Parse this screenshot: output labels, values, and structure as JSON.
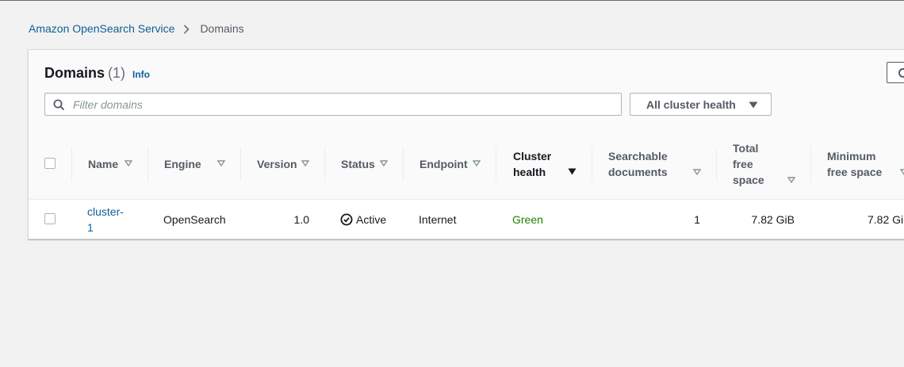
{
  "breadcrumb": {
    "service": "Amazon OpenSearch Service",
    "current": "Domains"
  },
  "panel": {
    "title": "Domains",
    "count": "(1)",
    "info": "Info",
    "search_placeholder": "Filter domains",
    "health_filter": "All cluster health"
  },
  "table": {
    "columns": [
      {
        "line1": "Name",
        "line2": "",
        "line3": ""
      },
      {
        "line1": "Engine",
        "line2": "",
        "line3": ""
      },
      {
        "line1": "Version",
        "line2": "",
        "line3": ""
      },
      {
        "line1": "Status",
        "line2": "",
        "line3": ""
      },
      {
        "line1": "Endpoint",
        "line2": "",
        "line3": ""
      },
      {
        "line1": "Cluster",
        "line2": "health",
        "line3": ""
      },
      {
        "line1": "Searchable",
        "line2": "documents",
        "line3": ""
      },
      {
        "line1": "Total",
        "line2": "free",
        "line3": "space"
      },
      {
        "line1": "Minimum",
        "line2": "free space",
        "line3": ""
      }
    ],
    "rows": [
      {
        "name_line1": "cluster-",
        "name_line2": "1",
        "engine": "OpenSearch",
        "version": "1.0",
        "status": "Active",
        "endpoint": "Internet",
        "cluster_health": "Green",
        "searchable_documents": "1",
        "total_free_space": "7.82 GiB",
        "minimum_free_space": "7.82 Gi"
      }
    ]
  },
  "colors": {
    "link": "#0f5f96",
    "health_green": "#1d8102",
    "background": "#f2f2f2"
  },
  "icons": [
    "chevron-right-icon",
    "refresh-icon",
    "search-icon",
    "caret-down-icon",
    "sort-icon",
    "sort-descending-icon",
    "status-check-icon"
  ]
}
